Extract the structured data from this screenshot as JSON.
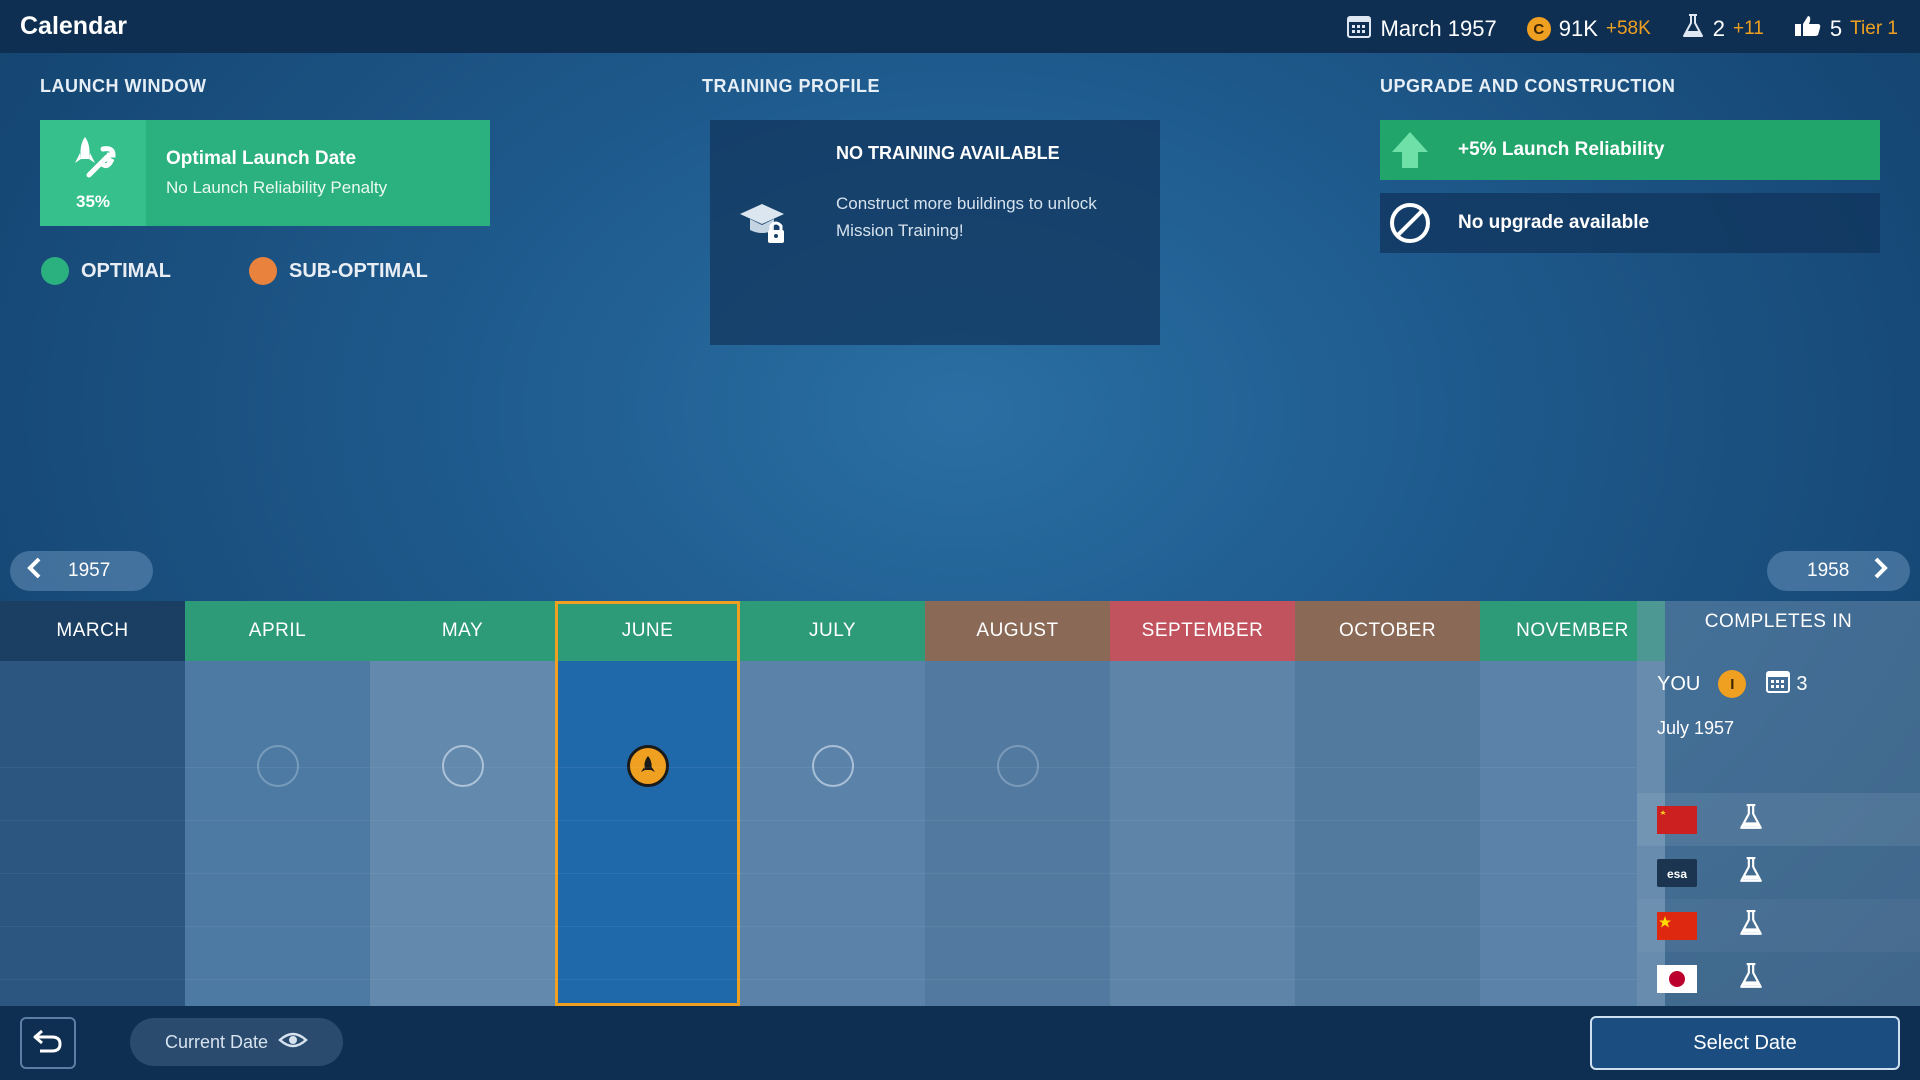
{
  "header": {
    "title": "Calendar",
    "date": "March 1957",
    "coins": "91K",
    "coins_delta": "+58K",
    "coin_symbol": "C",
    "science": "2",
    "science_delta": "+11",
    "reputation": "5",
    "tier": "Tier 1"
  },
  "launch_window": {
    "title": "LAUNCH WINDOW",
    "percent": "35%",
    "card_title": "Optimal Launch Date",
    "card_subtitle": "No Launch Reliability Penalty",
    "legend": [
      {
        "label": "OPTIMAL",
        "color": "#2bb07f"
      },
      {
        "label": "SUB-OPTIMAL",
        "color": "#e8823c"
      }
    ]
  },
  "training": {
    "title": "TRAINING PROFILE",
    "card_title": "NO TRAINING AVAILABLE",
    "card_text": "Construct more buildings to unlock Mission Training!"
  },
  "upgrade": {
    "title": "UPGRADE AND CONSTRUCTION",
    "bonus": "+5% Launch Reliability",
    "status": "No upgrade available"
  },
  "year_nav": {
    "prev": "1957",
    "next": "1958"
  },
  "months": [
    {
      "name": "MARCH",
      "head_color": "#1b3e63",
      "body_color": "#2c5680",
      "slot": "none"
    },
    {
      "name": "APRIL",
      "head_color": "#2d9a78",
      "body_color": "#4d7aa2",
      "slot": "faint"
    },
    {
      "name": "MAY",
      "head_color": "#2d9a78",
      "body_color": "#6389ad",
      "slot": "open"
    },
    {
      "name": "JUNE",
      "head_color": "#2d9a78",
      "body_color": "#1f68aa",
      "slot": "selected"
    },
    {
      "name": "JULY",
      "head_color": "#2d9a78",
      "body_color": "#5b83aa",
      "slot": "open"
    },
    {
      "name": "AUGUST",
      "head_color": "#8a6a56",
      "body_color": "#52799f",
      "slot": "faint"
    },
    {
      "name": "SEPTEMBER",
      "head_color": "#c0535e",
      "body_color": "#5e84a8",
      "slot": "none"
    },
    {
      "name": "OCTOBER",
      "head_color": "#8a6a56",
      "body_color": "#527a9f",
      "slot": "none"
    },
    {
      "name": "NOVEMBER",
      "head_color": "#2d9a78",
      "body_color": "#5b83aa",
      "slot": "none"
    }
  ],
  "completes": {
    "title": "COMPLETES IN",
    "you_label": "YOU",
    "coin_symbol": "I",
    "months": "3",
    "date": "July 1957",
    "rivals": [
      {
        "flag": "ussr"
      },
      {
        "flag": "esa",
        "flag_text": "esa"
      },
      {
        "flag": "china"
      },
      {
        "flag": "japan"
      }
    ]
  },
  "footer": {
    "current_date": "Current Date",
    "select_date": "Select Date"
  }
}
